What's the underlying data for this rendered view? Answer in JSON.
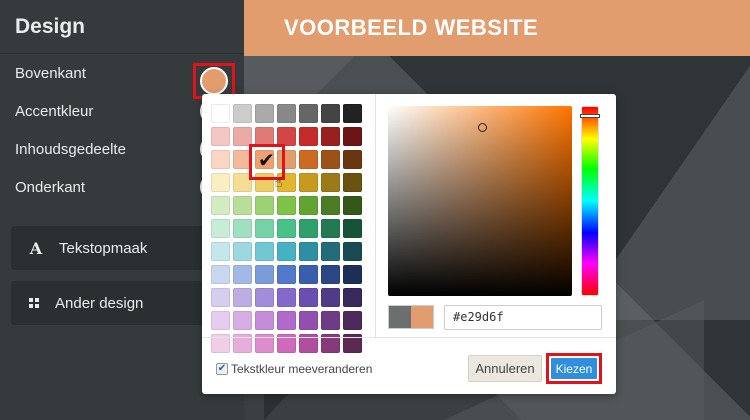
{
  "site": {
    "title": "VOORBEELD WEBSITE"
  },
  "sidebar": {
    "title": "Design",
    "rows": [
      {
        "label": "Bovenkant"
      },
      {
        "label": "Accentkleur"
      },
      {
        "label": "Inhoudsgedeelte"
      },
      {
        "label": "Onderkant"
      }
    ],
    "buttons": [
      {
        "label": "Tekstopmaak",
        "icon": "A"
      },
      {
        "label": "Ander design",
        "icon": "grid-icon"
      }
    ],
    "selected_color": "#e29d6f"
  },
  "picker": {
    "swatches": [
      [
        "#ffffff",
        "#cccccc",
        "#aaaaaa",
        "#888888",
        "#666666",
        "#444444",
        "#222222"
      ],
      [
        "#f4c7c3",
        "#ecaaa6",
        "#e07a77",
        "#d54545",
        "#c62b2b",
        "#9a1f1f",
        "#6d1414"
      ],
      [
        "#f9d6c4",
        "#f4b99b",
        "#efa06e",
        "#e29d6f",
        "#cc6a22",
        "#9c5119",
        "#6a3612"
      ],
      [
        "#faeec2",
        "#f5de94",
        "#f0cd63",
        "#e3b62f",
        "#c79a1f",
        "#9d7a17",
        "#6b5210"
      ],
      [
        "#d3ebc0",
        "#b8de9a",
        "#9dd273",
        "#7ec347",
        "#63a332",
        "#4b7d26",
        "#34581a"
      ],
      [
        "#c7ecd8",
        "#a0dfbf",
        "#76d2a4",
        "#49c088",
        "#2fa06c",
        "#237a52",
        "#175337"
      ],
      [
        "#c4e7ec",
        "#9dd8e0",
        "#73c7d4",
        "#45b1c2",
        "#2e8fa0",
        "#226c79",
        "#174a53"
      ],
      [
        "#c8d6ef",
        "#a3b9e5",
        "#7c9bda",
        "#5279cb",
        "#385eac",
        "#2a4683",
        "#1c2f59"
      ],
      [
        "#d6cdef",
        "#bcaee5",
        "#a18dd9",
        "#8469cb",
        "#6a4fb0",
        "#503b86",
        "#37295c"
      ],
      [
        "#e6cdef",
        "#d6aee5",
        "#c58dd9",
        "#b06acb",
        "#934fb0",
        "#703b86",
        "#4d295c"
      ],
      [
        "#f1cde8",
        "#e8aedb",
        "#dd8dcc",
        "#cf6abb",
        "#b04f9e",
        "#863b78",
        "#5c2953"
      ]
    ],
    "selected_swatch": "#e29d6f",
    "hex_value": "#e29d6f",
    "old_color": "#6b6f70",
    "new_color": "#e29d6f",
    "checkbox_label": "Tekstkleur meeveranderen",
    "checkbox_checked": true,
    "cancel_label": "Annuleren",
    "ok_label": "Kiezen"
  }
}
